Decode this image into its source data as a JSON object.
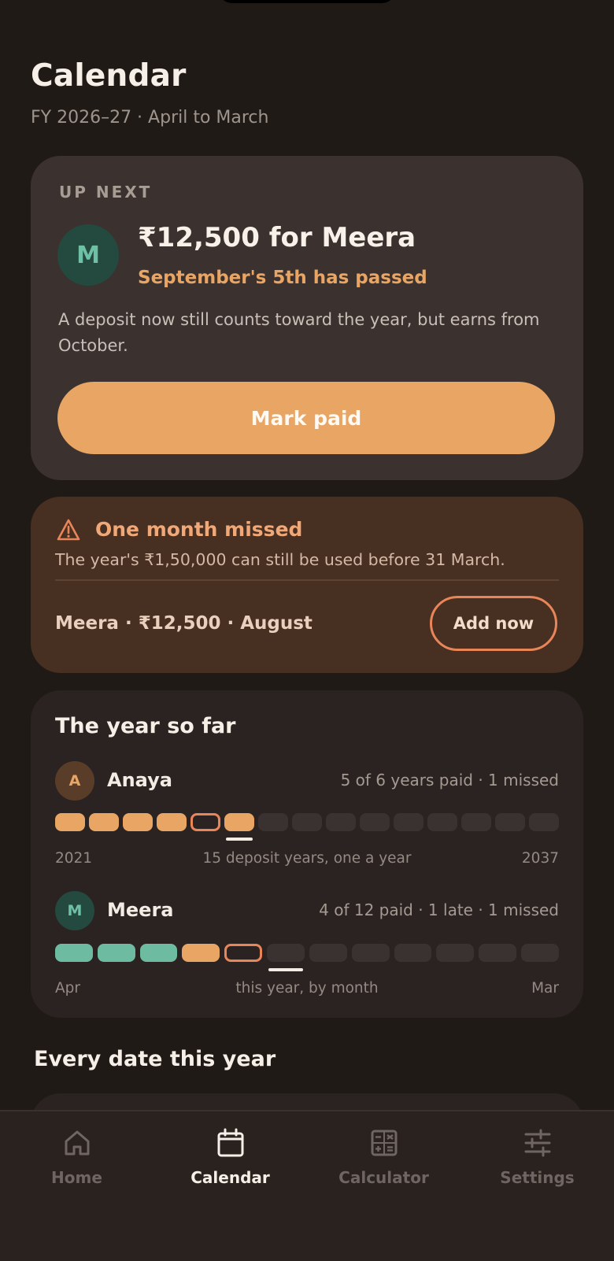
{
  "header": {
    "title": "Calendar",
    "subtitle": "FY 2026–27 · April to March"
  },
  "up_next": {
    "eyebrow": "UP NEXT",
    "avatar_initial": "M",
    "amount_line": "₹12,500 for Meera",
    "status": "September's 5th has passed",
    "body": "A deposit now still counts toward the year, but earns from October.",
    "button_label": "Mark paid"
  },
  "missed": {
    "icon": "warning-triangle-icon",
    "title": "One month missed",
    "body": "The year's ₹1,50,000 can still be used before 31 March.",
    "item": "Meera · ₹12,500 · August",
    "button_label": "Add now"
  },
  "year_so_far": {
    "title": "The year so far",
    "people": [
      {
        "initial": "A",
        "name": "Anaya",
        "stats": "5 of 6 years paid · 1 missed",
        "avatar_bg": "#5a3d28",
        "avatar_fg": "#e8a563",
        "segments": [
          "paid",
          "paid",
          "paid",
          "paid",
          "missed",
          "paid",
          "future",
          "future",
          "future",
          "future",
          "future",
          "future",
          "future",
          "future",
          "future"
        ],
        "current_index": 5,
        "axis": {
          "start": "2021",
          "middle": "15 deposit years, one a year",
          "end": "2037"
        }
      },
      {
        "initial": "M",
        "name": "Meera",
        "stats": "4 of 12 paid · 1 late · 1 missed",
        "avatar_bg": "#24493e",
        "avatar_fg": "#6fc1a6",
        "segments": [
          "paid",
          "paid",
          "paid",
          "late",
          "missed",
          "future",
          "future",
          "future",
          "future",
          "future",
          "future",
          "future"
        ],
        "current_index": 5,
        "axis": {
          "start": "Apr",
          "middle": "this year, by month",
          "end": "Mar"
        }
      }
    ]
  },
  "colors": {
    "anaya_paid": "#e8a563",
    "meera_paid": "#6dbba1",
    "late": "#e8a563",
    "missed_border": "#e8865a",
    "future": "#3a3230",
    "accent": "#e8a563"
  },
  "every_date": {
    "title": "Every date this year"
  },
  "nav": [
    {
      "label": "Home",
      "icon": "home-icon",
      "active": false
    },
    {
      "label": "Calendar",
      "icon": "calendar-icon",
      "active": true
    },
    {
      "label": "Calculator",
      "icon": "calculator-icon",
      "active": false
    },
    {
      "label": "Settings",
      "icon": "sliders-icon",
      "active": false
    }
  ]
}
